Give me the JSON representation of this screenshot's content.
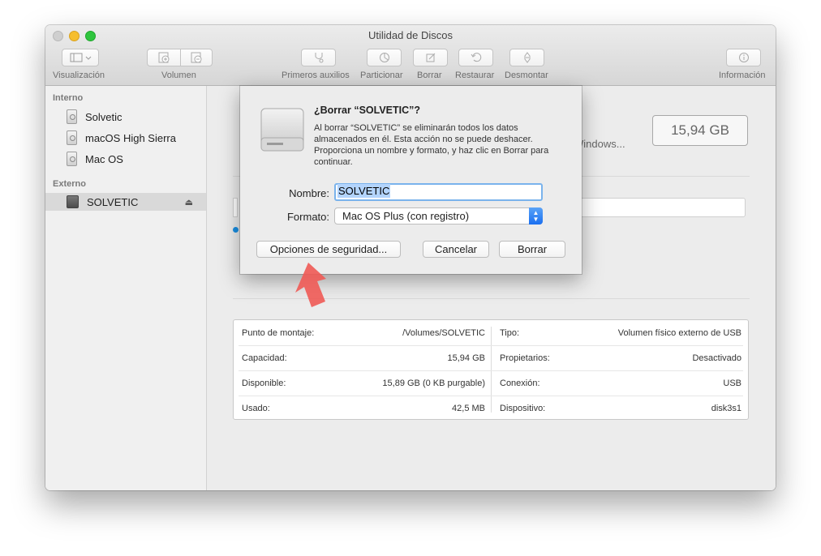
{
  "window": {
    "title": "Utilidad de Discos"
  },
  "toolbar": {
    "visualizacion": "Visualización",
    "volumen": "Volumen",
    "primeros_auxilios": "Primeros auxilios",
    "particionar": "Particionar",
    "borrar": "Borrar",
    "restaurar": "Restaurar",
    "desmontar": "Desmontar",
    "informacion": "Información",
    "icons": [
      "sidebar-view-icon",
      "chevron-down-icon",
      "add-volume-icon",
      "remove-volume-icon",
      "stethoscope-icon",
      "pie-chart-icon",
      "erase-icon",
      "restore-icon",
      "unmount-icon",
      "info-icon"
    ]
  },
  "sidebar": {
    "internal_header": "Interno",
    "internal_items": [
      "Solvetic",
      "macOS High Sierra",
      "Mac OS"
    ],
    "external_header": "Externo",
    "external_items": [
      "SOLVETIC"
    ]
  },
  "detail": {
    "capacity": "15,94 GB",
    "format_partial": "Windows..."
  },
  "dialog": {
    "title": "¿Borrar “SOLVETIC”?",
    "message": "Al borrar “SOLVETIC” se eliminarán todos los datos almacenados en él. Esta acción no se puede deshacer. Proporciona un nombre y formato, y haz clic en Borrar para continuar.",
    "name_label": "Nombre:",
    "name_value": "SOLVETIC",
    "format_label": "Formato:",
    "format_value": "Mac OS Plus (con registro)",
    "security_button": "Opciones de seguridad...",
    "cancel_button": "Cancelar",
    "erase_button": "Borrar"
  },
  "info": {
    "rows": [
      {
        "k1": "Punto de montaje:",
        "v1": "/Volumes/SOLVETIC",
        "k2": "Tipo:",
        "v2": "Volumen físico externo de USB"
      },
      {
        "k1": "Capacidad:",
        "v1": "15,94 GB",
        "k2": "Propietarios:",
        "v2": "Desactivado"
      },
      {
        "k1": "Disponible:",
        "v1": "15,89 GB (0 KB purgable)",
        "k2": "Conexión:",
        "v2": "USB"
      },
      {
        "k1": "Usado:",
        "v1": "42,5 MB",
        "k2": "Dispositivo:",
        "v2": "disk3s1"
      }
    ]
  },
  "colors": {
    "accent": "#1a6ff0",
    "highlight_arrow": "#ef5a55",
    "selection": "#b3d4fc"
  }
}
